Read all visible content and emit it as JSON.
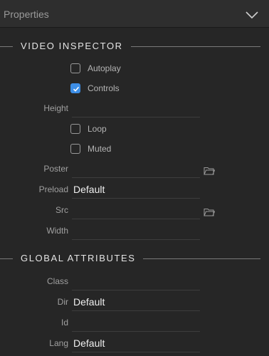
{
  "header": {
    "title": "Properties",
    "collapse_icon": "chevron-down-icon"
  },
  "video_inspector": {
    "title": "VIDEO INSPECTOR",
    "autoplay": {
      "label": "Autoplay",
      "checked": false
    },
    "controls": {
      "label": "Controls",
      "checked": true
    },
    "height": {
      "label": "Height",
      "value": ""
    },
    "loop": {
      "label": "Loop",
      "checked": false
    },
    "muted": {
      "label": "Muted",
      "checked": false
    },
    "poster": {
      "label": "Poster",
      "value": "",
      "icon": "folder-icon"
    },
    "preload": {
      "label": "Preload",
      "value": "Default"
    },
    "src": {
      "label": "Src",
      "value": "",
      "icon": "folder-icon"
    },
    "width": {
      "label": "Width",
      "value": ""
    }
  },
  "global_attributes": {
    "title": "GLOBAL ATTRIBUTES",
    "class": {
      "label": "Class",
      "value": ""
    },
    "dir": {
      "label": "Dir",
      "value": "Default"
    },
    "id": {
      "label": "Id",
      "value": ""
    },
    "lang": {
      "label": "Lang",
      "value": "Default"
    }
  },
  "colors": {
    "accent": "#3d8ee6",
    "background": "#262626"
  }
}
